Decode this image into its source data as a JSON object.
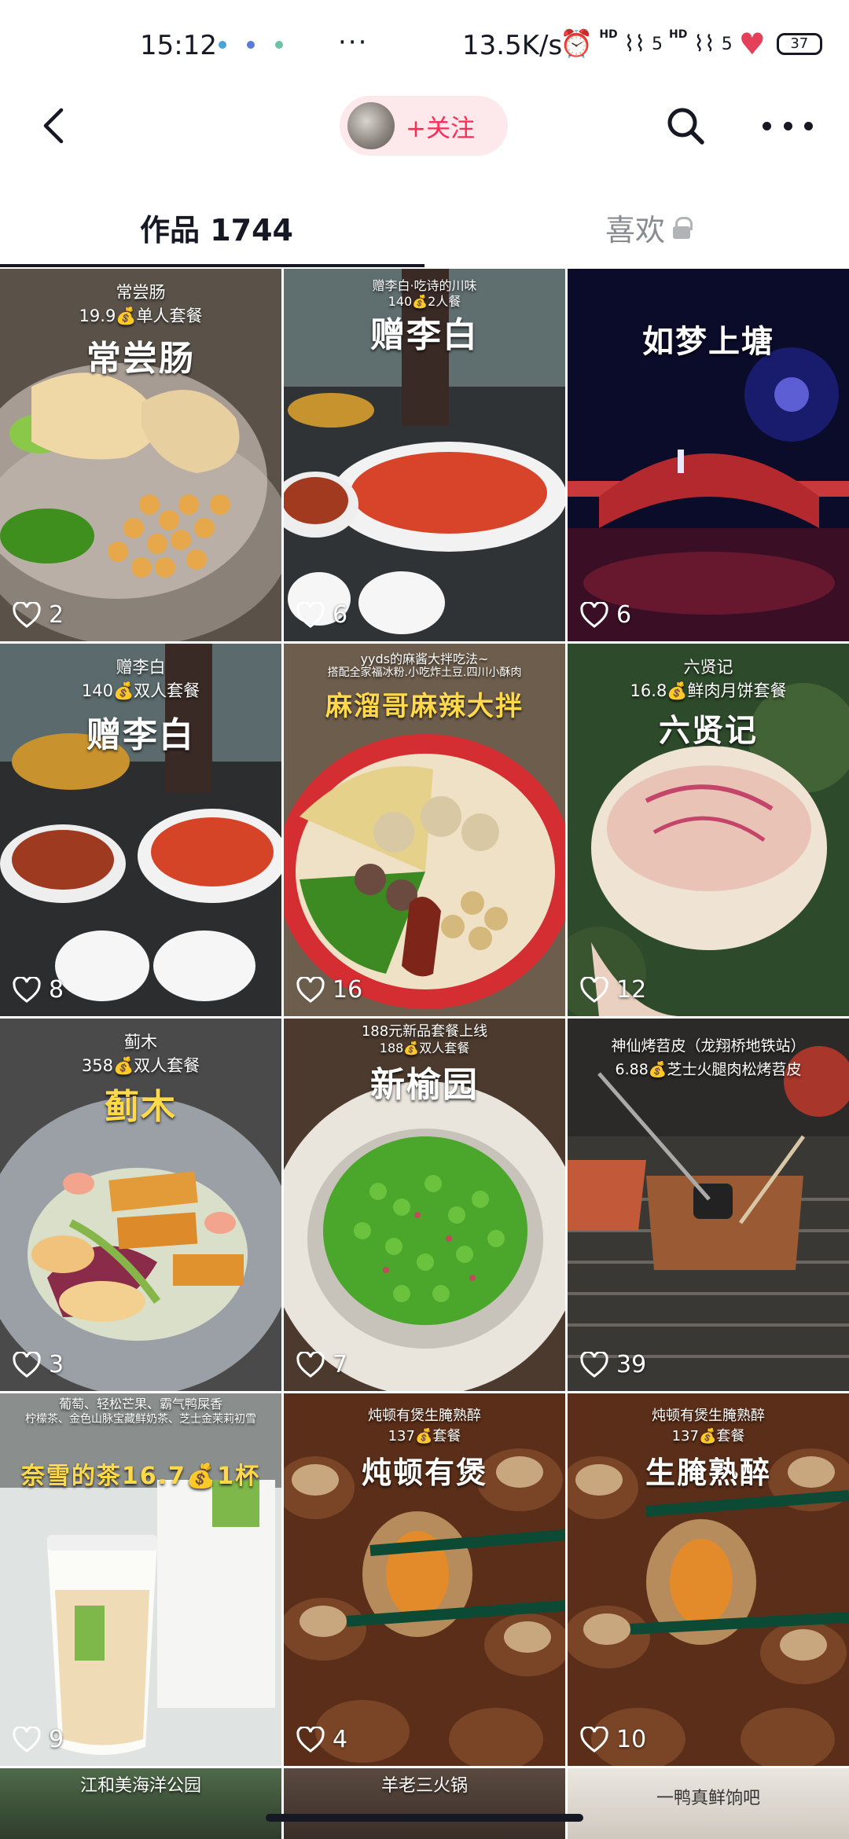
{
  "status_bar": {
    "time": "15:12",
    "more": "···",
    "net_speed": "13.5K/s",
    "signal_label_1": "HD",
    "signal_bars_1": "5",
    "signal_label_2": "HD",
    "signal_bars_2": "5",
    "battery": "37"
  },
  "nav": {
    "follow_label": "+关注"
  },
  "tabs": {
    "works_label": "作品 1744",
    "likes_label": "喜欢"
  },
  "colors": {
    "accent": "#fe2c55",
    "pill_bg": "#fde9ec"
  },
  "posts": [
    {
      "sub": "常尝肠",
      "sub2": "19.9💰单人套餐",
      "title": "常尝肠",
      "likes": "2"
    },
    {
      "sub": "赠李白·吃诗的川味",
      "sub2": "140💰2人餐",
      "title": "赠李白",
      "likes": "6"
    },
    {
      "sub": "",
      "sub2": "",
      "title": "如梦上塘",
      "likes": "6"
    },
    {
      "sub": "赠李白",
      "sub2": "140💰双人套餐",
      "title": "赠李白",
      "likes": "8"
    },
    {
      "sub": "yyds的麻酱大拌吃法~",
      "sub2": "搭配全家福冰粉.小吃炸土豆.四川小酥肉",
      "title": "麻溜哥麻辣大拌",
      "likes": "16"
    },
    {
      "sub": "六贤记",
      "sub2": "16.8💰鲜肉月饼套餐",
      "title": "六贤记",
      "likes": "12"
    },
    {
      "sub": "蓟木",
      "sub2": "358💰双人套餐",
      "title": "蓟木",
      "likes": "3"
    },
    {
      "sub": "188元新品套餐上线",
      "sub2": "188💰双人套餐",
      "title": "新榆园",
      "likes": "7"
    },
    {
      "sub": "神仙烤苕皮（龙翔桥地铁站）",
      "sub2": "6.88💰芝士火腿肉松烤苕皮",
      "title": "",
      "likes": "39"
    },
    {
      "sub": "葡萄、轻松芒果、霸气鸭屎香",
      "sub2": "柠檬茶、金色山脉宝藏鲜奶茶、芝士金茉莉初雪",
      "title": "奈雪的茶16.7💰1杯",
      "likes": "9"
    },
    {
      "sub": "炖顿有煲生腌熟醉",
      "sub2": "137💰套餐",
      "title": "炖顿有煲",
      "likes": "4"
    },
    {
      "sub": "炖顿有煲生腌熟醉",
      "sub2": "137💰套餐",
      "title": "生腌熟醉",
      "likes": "10"
    }
  ],
  "peek_posts": [
    {
      "title": "江和美海洋公园"
    },
    {
      "title": "羊老三火锅"
    },
    {
      "title": "一鸭真鲜饷吧"
    }
  ]
}
